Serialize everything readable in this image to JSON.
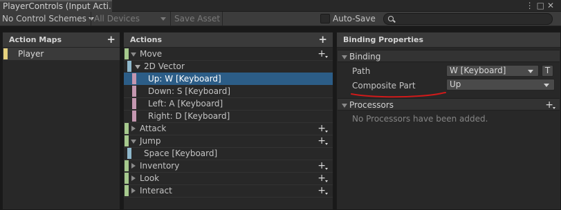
{
  "window": {
    "tab_title": "PlayerControls (Input Acti...",
    "menu_glyph": "⋮",
    "maximize_glyph": "□",
    "close_glyph": "✕"
  },
  "toolbar": {
    "control_schemes": "No Control Schemes",
    "devices": "All Devices",
    "save_asset": "Save Asset",
    "auto_save": "Auto-Save",
    "search_value": ""
  },
  "action_maps": {
    "header": "Action Maps",
    "add_glyph": "+",
    "items": [
      {
        "label": "Player",
        "color": "#e6d17e"
      }
    ]
  },
  "actions": {
    "header": "Actions",
    "add_glyph": "+",
    "items": [
      {
        "label": "Move",
        "kind": "action",
        "expanded": true
      },
      {
        "label": "2D Vector",
        "kind": "composite",
        "expanded": true
      },
      {
        "label": "Up: W [Keyboard]",
        "kind": "part",
        "selected": true
      },
      {
        "label": "Down: S [Keyboard]",
        "kind": "part"
      },
      {
        "label": "Left: A [Keyboard]",
        "kind": "part"
      },
      {
        "label": "Right: D [Keyboard]",
        "kind": "part"
      },
      {
        "label": "Attack",
        "kind": "action",
        "expanded": false
      },
      {
        "label": "Jump",
        "kind": "action",
        "expanded": true
      },
      {
        "label": "Space [Keyboard]",
        "kind": "binding"
      },
      {
        "label": "Inventory",
        "kind": "action",
        "expanded": false
      },
      {
        "label": "Look",
        "kind": "action",
        "expanded": false
      },
      {
        "label": "Interact",
        "kind": "action",
        "expanded": false
      }
    ]
  },
  "properties": {
    "header": "Binding Properties",
    "binding_section": "Binding",
    "path_label": "Path",
    "path_value": "W [Keyboard]",
    "t_button": "T",
    "composite_part_label": "Composite Part",
    "composite_part_value": "Up",
    "processors_section": "Processors",
    "processors_add_glyph": "+",
    "processors_empty": "No Processors have been added."
  },
  "colors": {
    "action": "#a6c98d",
    "composite": "#8fb8cc",
    "part": "#c497b0",
    "selection": "#2c5d87",
    "annotation": "#d11a1a"
  }
}
